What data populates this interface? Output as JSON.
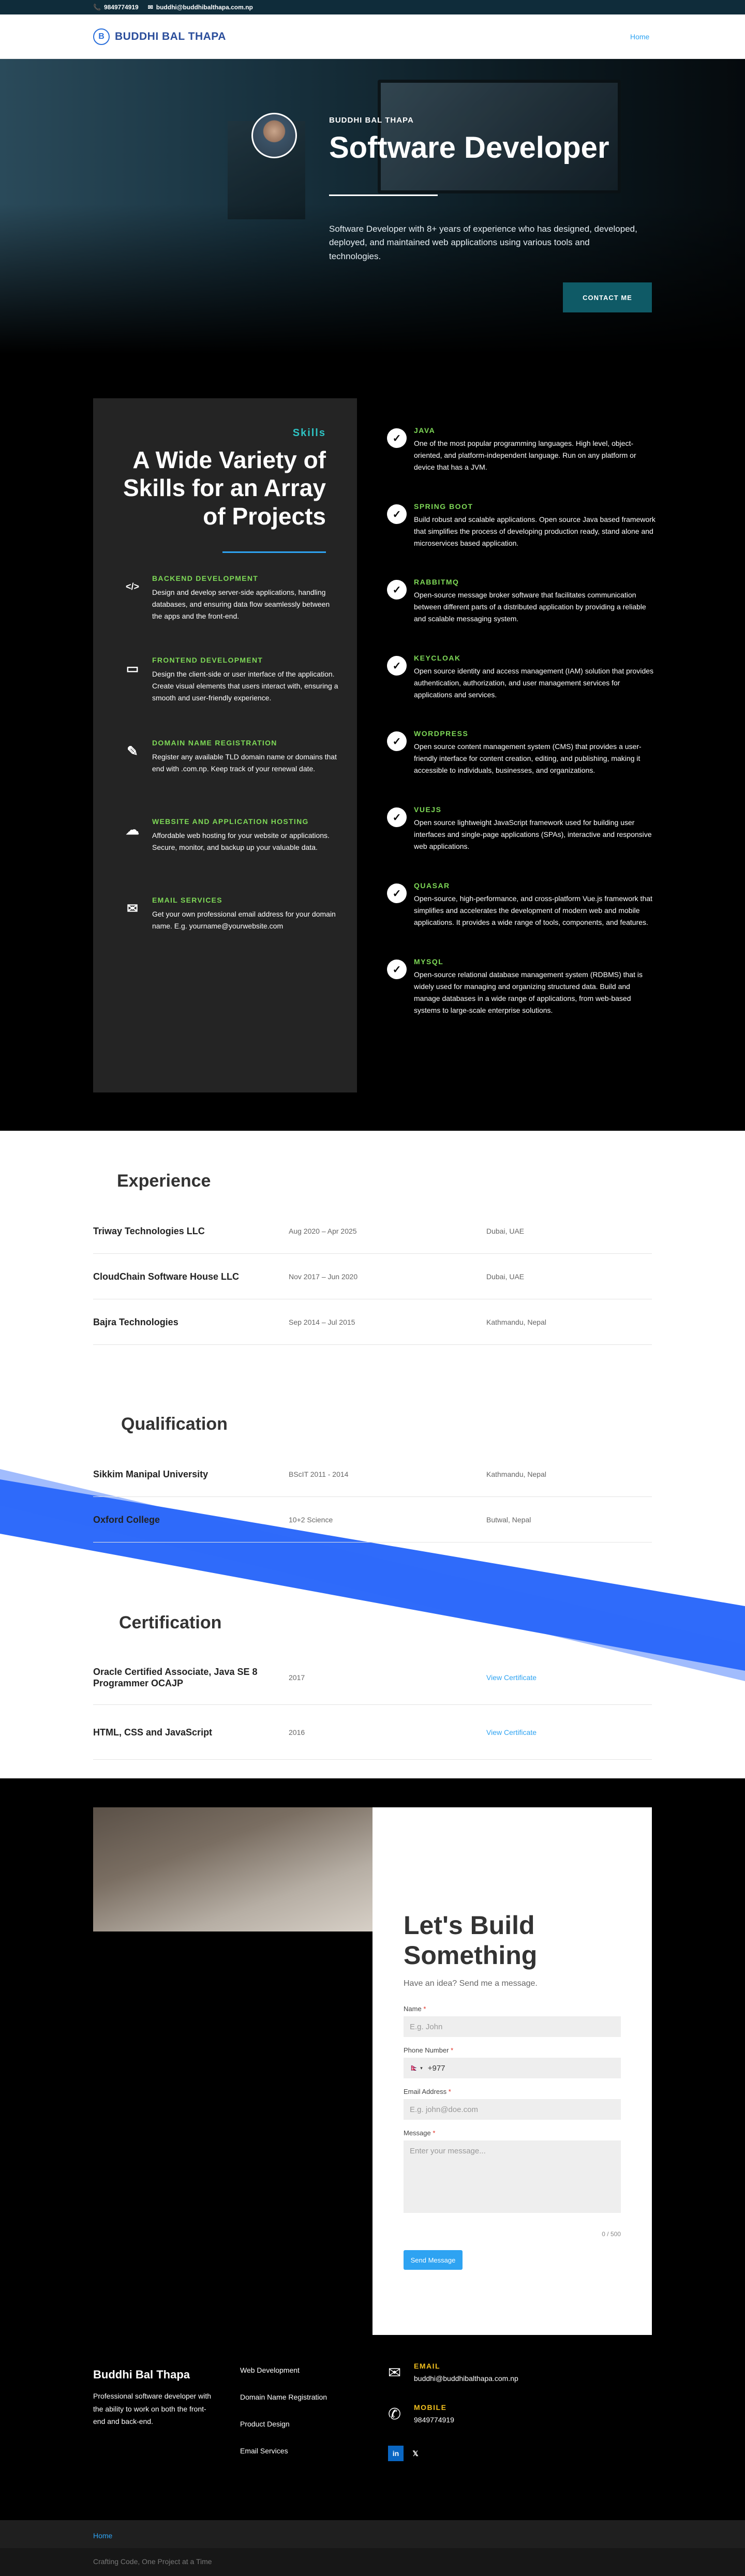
{
  "topbar": {
    "phone": "9849774919",
    "email": "buddhi@buddhibalthapa.com.np"
  },
  "header": {
    "logo_text": "BUDDHI BAL THAPA",
    "logo_mark": "B",
    "nav": [
      {
        "label": "Home"
      }
    ]
  },
  "hero": {
    "name": "BUDDHI BAL THAPA",
    "title": "Software Developer",
    "description": "Software Developer with 8+ years of experience who has designed, developed, deployed, and maintained web applications using various tools and technologies.",
    "cta": "CONTACT ME"
  },
  "skills": {
    "kicker": "Skills",
    "title": "A Wide Variety of Skills for an Array of Projects",
    "services": [
      {
        "icon": "code-icon",
        "glyph": "</>",
        "title": "BACKEND DEVELOPMENT",
        "text": "Design and develop server-side applications, handling databases, and ensuring data flow seamlessly between the apps and the front-end."
      },
      {
        "icon": "monitor-icon",
        "glyph": "▭",
        "title": "FRONTEND DEVELOPMENT",
        "text": "Design the client-side or user interface of the application. Create visual elements that users interact with, ensuring a smooth and user-friendly experience."
      },
      {
        "icon": "domain-edit-icon",
        "glyph": "✎",
        "title": "DOMAIN NAME REGISTRATION",
        "text": "Register any available TLD domain name or domains that end with .com.np. Keep track of your renewal date."
      },
      {
        "icon": "cloud-upload-icon",
        "glyph": "☁",
        "title": "WEBSITE AND APPLICATION HOSTING",
        "text": "Affordable web hosting for your website or applications. Secure, monitor, and backup up your valuable data."
      },
      {
        "icon": "email-icon",
        "glyph": "✉",
        "title": "EMAIL SERVICES",
        "text": "Get your own professional email address for your domain name. E.g. yourname@yourwebsite.com"
      }
    ],
    "tech": [
      {
        "title": "JAVA",
        "text": "One of the most popular programming languages. High level, object-oriented, and platform-independent language. Run on any platform or device that has a JVM."
      },
      {
        "title": "SPRING BOOT",
        "text": "Build robust and scalable applications. Open source Java based framework that simplifies the process of developing production ready, stand alone and microservices based application."
      },
      {
        "title": "RABBITMQ",
        "text": "Open-source message broker software that facilitates communication between different parts of a distributed application by providing a reliable and scalable messaging system."
      },
      {
        "title": "KEYCLOAK",
        "text": "Open source identity and access management (IAM) solution that provides authentication, authorization, and user management services for applications and services."
      },
      {
        "title": "WORDPRESS",
        "text": "Open source content management system (CMS) that provides a user-friendly interface for content creation, editing, and publishing, making it accessible to individuals, businesses, and organizations."
      },
      {
        "title": "VUEJS",
        "text": "Open source lightweight JavaScript framework used for building user interfaces and single-page applications (SPAs), interactive and responsive web applications."
      },
      {
        "title": "QUASAR",
        "text": "Open-source, high-performance, and cross-platform Vue.js framework that simplifies and accelerates the development of modern web and mobile applications. It provides a wide range of tools, components, and features."
      },
      {
        "title": "MYSQL",
        "text": "Open-source relational database management system (RDBMS) that is widely used for managing and organizing structured data. Build and manage databases in a wide range of applications, from web-based systems to large-scale enterprise solutions."
      }
    ]
  },
  "experience": {
    "title": "Experience",
    "rows": [
      {
        "company": "Triway Technologies LLC",
        "period": "Aug 2020 – Apr 2025",
        "location": "Dubai, UAE"
      },
      {
        "company": "CloudChain Software House LLC",
        "period": "Nov 2017 – Jun 2020",
        "location": "Dubai, UAE"
      },
      {
        "company": "Bajra Technologies",
        "period": "Sep 2014 – Jul 2015",
        "location": "Kathmandu, Nepal"
      }
    ]
  },
  "qualification": {
    "title": "Qualification",
    "rows": [
      {
        "school": "Sikkim Manipal University",
        "degree": "BScIT 2011 - 2014",
        "location": "Kathmandu, Nepal"
      },
      {
        "school": "Oxford College",
        "degree": "10+2 Science",
        "location": "Butwal, Nepal"
      }
    ]
  },
  "certification": {
    "title": "Certification",
    "rows": [
      {
        "name": "Oracle Certified Associate, Java SE 8 Programmer OCAJP",
        "year": "2017",
        "link": "View Certificate"
      },
      {
        "name": "HTML, CSS and JavaScript",
        "year": "2016",
        "link": "View Certificate"
      }
    ]
  },
  "contact": {
    "title": "Let's Build Something",
    "subtitle": "Have an idea? Send me a message.",
    "name_label": "Name",
    "name_placeholder": "E.g. John",
    "phone_label": "Phone Number",
    "phone_value": "+977",
    "phone_flag": "🇳🇵",
    "email_label": "Email Address",
    "email_placeholder": "E.g. john@doe.com",
    "message_label": "Message",
    "message_placeholder": "Enter your message...",
    "char_count": "0 / 500",
    "required": "*",
    "submit": "Send Message"
  },
  "footer": {
    "brand": "Buddhi Bal Thapa",
    "description": "Professional software developer with the ability to work on both the front-end and back-end.",
    "links": [
      "Web Development",
      "Domain Name Registration",
      "Product Design",
      "Email Services"
    ],
    "email_label": "EMAIL",
    "email": "buddhi@buddhibalthapa.com.np",
    "mobile_label": "MOBILE",
    "mobile": "9849774919",
    "social": [
      {
        "icon": "linkedin-icon",
        "glyph": "in"
      },
      {
        "icon": "x-icon",
        "glyph": "𝕏"
      }
    ],
    "bottom_nav": "Home",
    "tagline": "Crafting Code, One Project at a Time"
  }
}
